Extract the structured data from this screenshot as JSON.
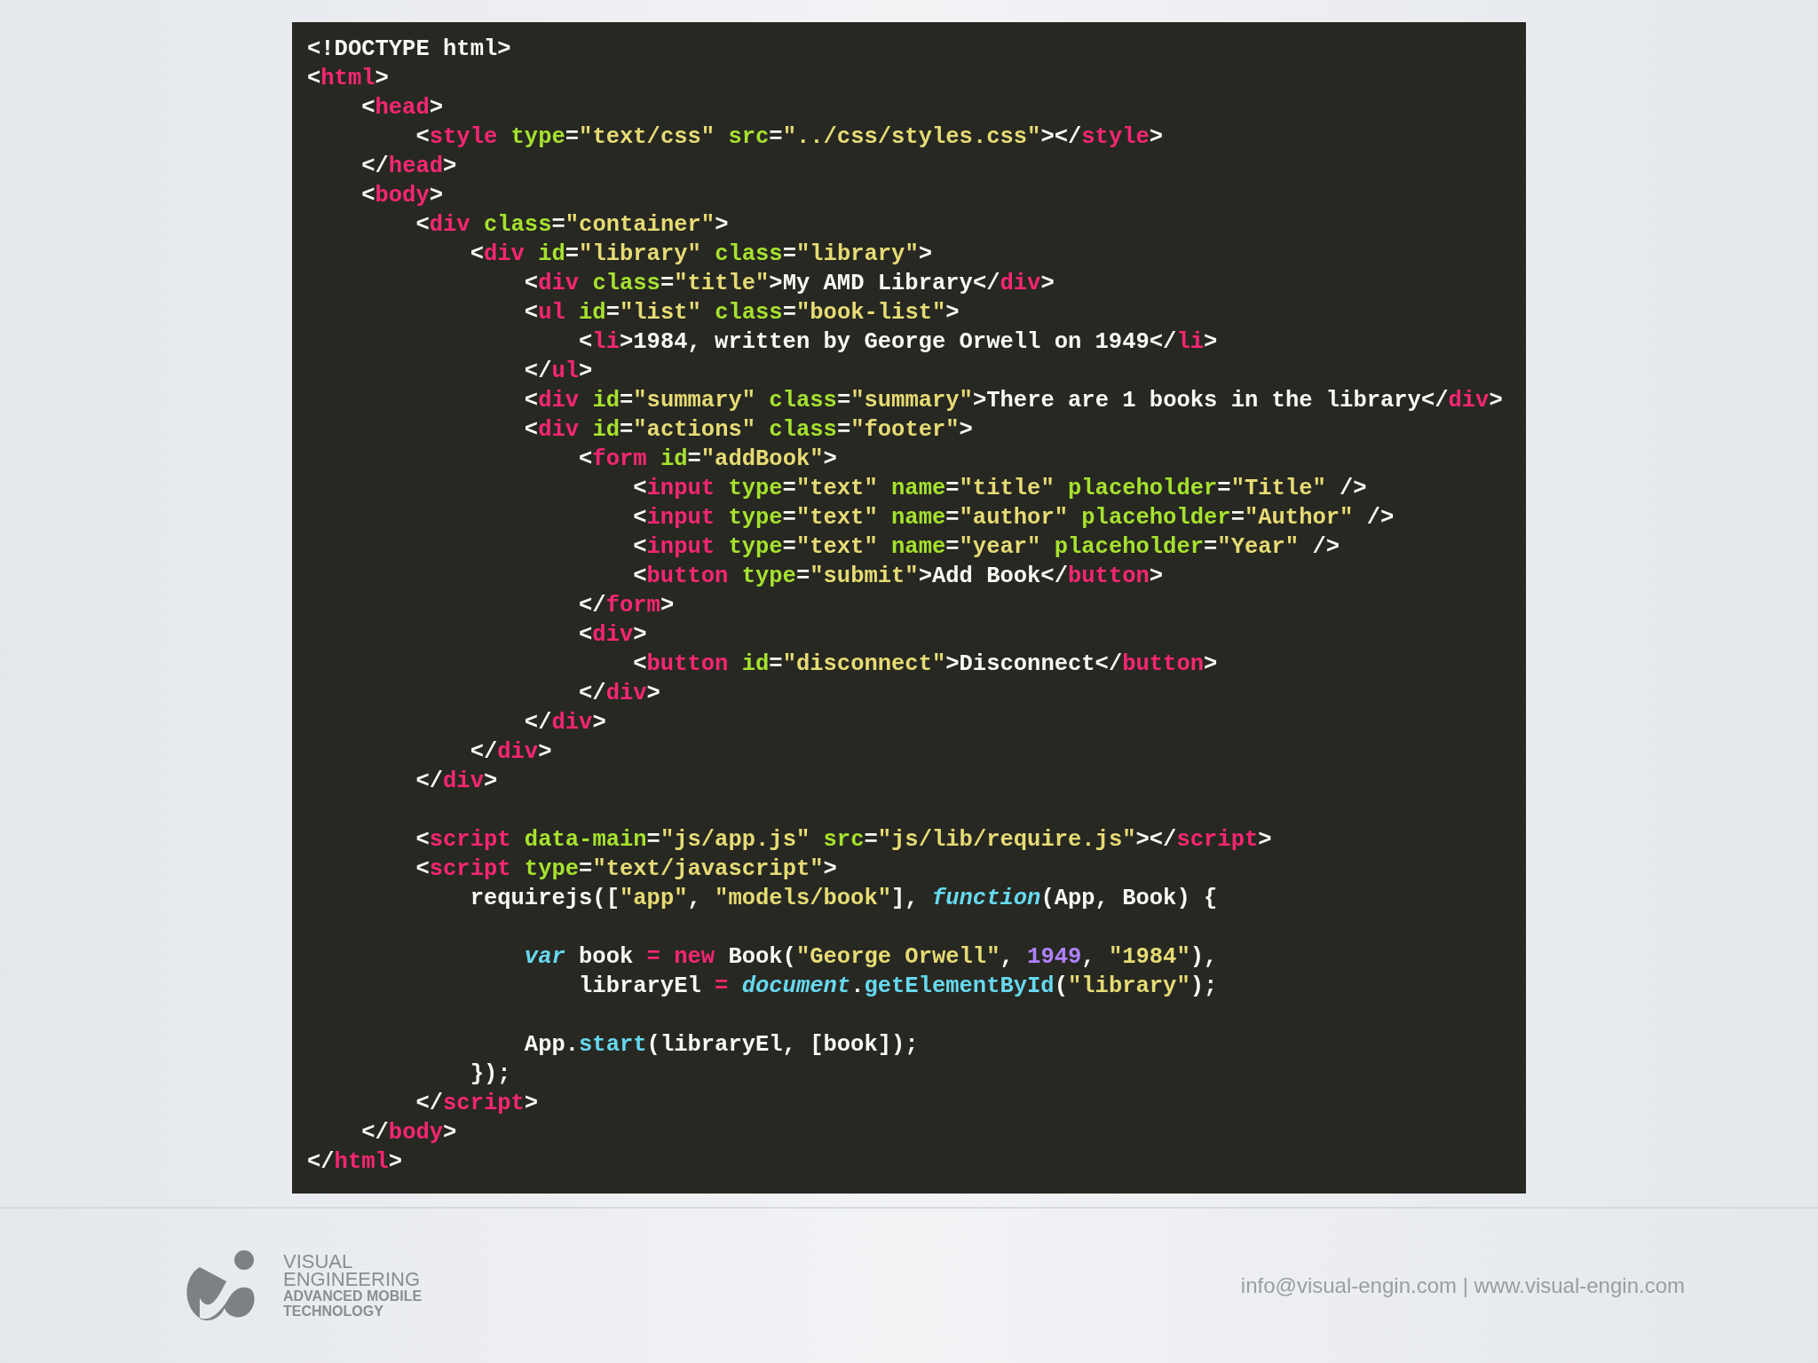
{
  "code_lines": [
    {
      "kind": "code",
      "tokens": [
        {
          "kind": "p",
          "text": "<!DOCTYPE html>"
        }
      ]
    },
    {
      "kind": "code",
      "tokens": [
        {
          "kind": "p",
          "text": "<"
        },
        {
          "kind": "t",
          "text": "html"
        },
        {
          "kind": "p",
          "text": ">"
        }
      ]
    },
    {
      "kind": "code",
      "tokens": [
        {
          "kind": "p",
          "text": "    <"
        },
        {
          "kind": "t",
          "text": "head"
        },
        {
          "kind": "p",
          "text": ">"
        }
      ]
    },
    {
      "kind": "code",
      "tokens": [
        {
          "kind": "p",
          "text": "        <"
        },
        {
          "kind": "t",
          "text": "style"
        },
        {
          "kind": "a",
          "text": " type"
        },
        {
          "kind": "p",
          "text": "="
        },
        {
          "kind": "s",
          "text": "\"text/css\""
        },
        {
          "kind": "a",
          "text": " src"
        },
        {
          "kind": "p",
          "text": "="
        },
        {
          "kind": "s",
          "text": "\"../css/styles.css\""
        },
        {
          "kind": "p",
          "text": "></"
        },
        {
          "kind": "t",
          "text": "style"
        },
        {
          "kind": "p",
          "text": ">"
        }
      ]
    },
    {
      "kind": "code",
      "tokens": [
        {
          "kind": "p",
          "text": "    </"
        },
        {
          "kind": "t",
          "text": "head"
        },
        {
          "kind": "p",
          "text": ">"
        }
      ]
    },
    {
      "kind": "code",
      "tokens": [
        {
          "kind": "p",
          "text": "    <"
        },
        {
          "kind": "t",
          "text": "body"
        },
        {
          "kind": "p",
          "text": ">"
        }
      ]
    },
    {
      "kind": "code",
      "tokens": [
        {
          "kind": "p",
          "text": "        <"
        },
        {
          "kind": "t",
          "text": "div"
        },
        {
          "kind": "a",
          "text": " class"
        },
        {
          "kind": "p",
          "text": "="
        },
        {
          "kind": "s",
          "text": "\"container\""
        },
        {
          "kind": "p",
          "text": ">"
        }
      ]
    },
    {
      "kind": "code",
      "tokens": [
        {
          "kind": "p",
          "text": "            <"
        },
        {
          "kind": "t",
          "text": "div"
        },
        {
          "kind": "a",
          "text": " id"
        },
        {
          "kind": "p",
          "text": "="
        },
        {
          "kind": "s",
          "text": "\"library\""
        },
        {
          "kind": "a",
          "text": " class"
        },
        {
          "kind": "p",
          "text": "="
        },
        {
          "kind": "s",
          "text": "\"library\""
        },
        {
          "kind": "p",
          "text": ">"
        }
      ]
    },
    {
      "kind": "code",
      "tokens": [
        {
          "kind": "p",
          "text": "                <"
        },
        {
          "kind": "t",
          "text": "div"
        },
        {
          "kind": "a",
          "text": " class"
        },
        {
          "kind": "p",
          "text": "="
        },
        {
          "kind": "s",
          "text": "\"title\""
        },
        {
          "kind": "p",
          "text": ">My AMD Library</"
        },
        {
          "kind": "t",
          "text": "div"
        },
        {
          "kind": "p",
          "text": ">"
        }
      ]
    },
    {
      "kind": "code",
      "tokens": [
        {
          "kind": "p",
          "text": "                <"
        },
        {
          "kind": "t",
          "text": "ul"
        },
        {
          "kind": "a",
          "text": " id"
        },
        {
          "kind": "p",
          "text": "="
        },
        {
          "kind": "s",
          "text": "\"list\""
        },
        {
          "kind": "a",
          "text": " class"
        },
        {
          "kind": "p",
          "text": "="
        },
        {
          "kind": "s",
          "text": "\"book-list\""
        },
        {
          "kind": "p",
          "text": ">"
        }
      ]
    },
    {
      "kind": "code",
      "tokens": [
        {
          "kind": "p",
          "text": "                    <"
        },
        {
          "kind": "t",
          "text": "li"
        },
        {
          "kind": "p",
          "text": ">1984, written by George Orwell on 1949</"
        },
        {
          "kind": "t",
          "text": "li"
        },
        {
          "kind": "p",
          "text": ">"
        }
      ]
    },
    {
      "kind": "code",
      "tokens": [
        {
          "kind": "p",
          "text": "                </"
        },
        {
          "kind": "t",
          "text": "ul"
        },
        {
          "kind": "p",
          "text": ">"
        }
      ]
    },
    {
      "kind": "code",
      "tokens": [
        {
          "kind": "p",
          "text": "                <"
        },
        {
          "kind": "t",
          "text": "div"
        },
        {
          "kind": "a",
          "text": " id"
        },
        {
          "kind": "p",
          "text": "="
        },
        {
          "kind": "s",
          "text": "\"summary\""
        },
        {
          "kind": "a",
          "text": " class"
        },
        {
          "kind": "p",
          "text": "="
        },
        {
          "kind": "s",
          "text": "\"summary\""
        },
        {
          "kind": "p",
          "text": ">There are 1 books in the library</"
        },
        {
          "kind": "t",
          "text": "div"
        },
        {
          "kind": "p",
          "text": ">"
        }
      ]
    },
    {
      "kind": "code",
      "tokens": [
        {
          "kind": "p",
          "text": "                <"
        },
        {
          "kind": "t",
          "text": "div"
        },
        {
          "kind": "a",
          "text": " id"
        },
        {
          "kind": "p",
          "text": "="
        },
        {
          "kind": "s",
          "text": "\"actions\""
        },
        {
          "kind": "a",
          "text": " class"
        },
        {
          "kind": "p",
          "text": "="
        },
        {
          "kind": "s",
          "text": "\"footer\""
        },
        {
          "kind": "p",
          "text": ">"
        }
      ]
    },
    {
      "kind": "code",
      "tokens": [
        {
          "kind": "p",
          "text": "                    <"
        },
        {
          "kind": "t",
          "text": "form"
        },
        {
          "kind": "a",
          "text": " id"
        },
        {
          "kind": "p",
          "text": "="
        },
        {
          "kind": "s",
          "text": "\"addBook\""
        },
        {
          "kind": "p",
          "text": ">"
        }
      ]
    },
    {
      "kind": "code",
      "tokens": [
        {
          "kind": "p",
          "text": "                        <"
        },
        {
          "kind": "t",
          "text": "input"
        },
        {
          "kind": "a",
          "text": " type"
        },
        {
          "kind": "p",
          "text": "="
        },
        {
          "kind": "s",
          "text": "\"text\""
        },
        {
          "kind": "a",
          "text": " name"
        },
        {
          "kind": "p",
          "text": "="
        },
        {
          "kind": "s",
          "text": "\"title\""
        },
        {
          "kind": "a",
          "text": " placeholder"
        },
        {
          "kind": "p",
          "text": "="
        },
        {
          "kind": "s",
          "text": "\"Title\""
        },
        {
          "kind": "p",
          "text": " />"
        }
      ]
    },
    {
      "kind": "code",
      "tokens": [
        {
          "kind": "p",
          "text": "                        <"
        },
        {
          "kind": "t",
          "text": "input"
        },
        {
          "kind": "a",
          "text": " type"
        },
        {
          "kind": "p",
          "text": "="
        },
        {
          "kind": "s",
          "text": "\"text\""
        },
        {
          "kind": "a",
          "text": " name"
        },
        {
          "kind": "p",
          "text": "="
        },
        {
          "kind": "s",
          "text": "\"author\""
        },
        {
          "kind": "a",
          "text": " placeholder"
        },
        {
          "kind": "p",
          "text": "="
        },
        {
          "kind": "s",
          "text": "\"Author\""
        },
        {
          "kind": "p",
          "text": " />"
        }
      ]
    },
    {
      "kind": "code",
      "tokens": [
        {
          "kind": "p",
          "text": "                        <"
        },
        {
          "kind": "t",
          "text": "input"
        },
        {
          "kind": "a",
          "text": " type"
        },
        {
          "kind": "p",
          "text": "="
        },
        {
          "kind": "s",
          "text": "\"text\""
        },
        {
          "kind": "a",
          "text": " name"
        },
        {
          "kind": "p",
          "text": "="
        },
        {
          "kind": "s",
          "text": "\"year\""
        },
        {
          "kind": "a",
          "text": " placeholder"
        },
        {
          "kind": "p",
          "text": "="
        },
        {
          "kind": "s",
          "text": "\"Year\""
        },
        {
          "kind": "p",
          "text": " />"
        }
      ]
    },
    {
      "kind": "code",
      "tokens": [
        {
          "kind": "p",
          "text": "                        <"
        },
        {
          "kind": "t",
          "text": "button"
        },
        {
          "kind": "a",
          "text": " type"
        },
        {
          "kind": "p",
          "text": "="
        },
        {
          "kind": "s",
          "text": "\"submit\""
        },
        {
          "kind": "p",
          "text": ">Add Book</"
        },
        {
          "kind": "t",
          "text": "button"
        },
        {
          "kind": "p",
          "text": ">"
        }
      ]
    },
    {
      "kind": "code",
      "tokens": [
        {
          "kind": "p",
          "text": "                    </"
        },
        {
          "kind": "t",
          "text": "form"
        },
        {
          "kind": "p",
          "text": ">"
        }
      ]
    },
    {
      "kind": "code",
      "tokens": [
        {
          "kind": "p",
          "text": "                    <"
        },
        {
          "kind": "t",
          "text": "div"
        },
        {
          "kind": "p",
          "text": ">"
        }
      ]
    },
    {
      "kind": "code",
      "tokens": [
        {
          "kind": "p",
          "text": "                        <"
        },
        {
          "kind": "t",
          "text": "button"
        },
        {
          "kind": "a",
          "text": " id"
        },
        {
          "kind": "p",
          "text": "="
        },
        {
          "kind": "s",
          "text": "\"disconnect\""
        },
        {
          "kind": "p",
          "text": ">Disconnect</"
        },
        {
          "kind": "t",
          "text": "button"
        },
        {
          "kind": "p",
          "text": ">"
        }
      ]
    },
    {
      "kind": "code",
      "tokens": [
        {
          "kind": "p",
          "text": "                    </"
        },
        {
          "kind": "t",
          "text": "div"
        },
        {
          "kind": "p",
          "text": ">"
        }
      ]
    },
    {
      "kind": "code",
      "tokens": [
        {
          "kind": "p",
          "text": "                </"
        },
        {
          "kind": "t",
          "text": "div"
        },
        {
          "kind": "p",
          "text": ">"
        }
      ]
    },
    {
      "kind": "code",
      "tokens": [
        {
          "kind": "p",
          "text": "            </"
        },
        {
          "kind": "t",
          "text": "div"
        },
        {
          "kind": "p",
          "text": ">"
        }
      ]
    },
    {
      "kind": "code",
      "tokens": [
        {
          "kind": "p",
          "text": "        </"
        },
        {
          "kind": "t",
          "text": "div"
        },
        {
          "kind": "p",
          "text": ">"
        }
      ]
    },
    {
      "kind": "blank"
    },
    {
      "kind": "code",
      "tokens": [
        {
          "kind": "p",
          "text": "        <"
        },
        {
          "kind": "t",
          "text": "script"
        },
        {
          "kind": "a",
          "text": " data-main"
        },
        {
          "kind": "p",
          "text": "="
        },
        {
          "kind": "s",
          "text": "\"js/app.js\""
        },
        {
          "kind": "a",
          "text": " src"
        },
        {
          "kind": "p",
          "text": "="
        },
        {
          "kind": "s",
          "text": "\"js/lib/require.js\""
        },
        {
          "kind": "p",
          "text": "></"
        },
        {
          "kind": "t",
          "text": "script"
        },
        {
          "kind": "p",
          "text": ">"
        }
      ]
    },
    {
      "kind": "code",
      "tokens": [
        {
          "kind": "p",
          "text": "        <"
        },
        {
          "kind": "t",
          "text": "script"
        },
        {
          "kind": "a",
          "text": " type"
        },
        {
          "kind": "p",
          "text": "="
        },
        {
          "kind": "s",
          "text": "\"text/javascript\""
        },
        {
          "kind": "p",
          "text": ">"
        }
      ]
    },
    {
      "kind": "code",
      "tokens": [
        {
          "kind": "p",
          "text": "            requirejs(["
        },
        {
          "kind": "s",
          "text": "\"app\""
        },
        {
          "kind": "p",
          "text": ", "
        },
        {
          "kind": "s",
          "text": "\"models/book\""
        },
        {
          "kind": "p",
          "text": "], "
        },
        {
          "kind": "i",
          "text": "function"
        },
        {
          "kind": "p",
          "text": "(App, Book) {"
        }
      ]
    },
    {
      "kind": "blank"
    },
    {
      "kind": "code",
      "tokens": [
        {
          "kind": "i",
          "text": "                var"
        },
        {
          "kind": "p",
          "text": " book "
        },
        {
          "kind": "k",
          "text": "= new"
        },
        {
          "kind": "p",
          "text": " Book("
        },
        {
          "kind": "s",
          "text": "\"George Orwell\""
        },
        {
          "kind": "p",
          "text": ", "
        },
        {
          "kind": "n",
          "text": "1949"
        },
        {
          "kind": "p",
          "text": ", "
        },
        {
          "kind": "s",
          "text": "\"1984\""
        },
        {
          "kind": "p",
          "text": "),"
        }
      ]
    },
    {
      "kind": "code",
      "tokens": [
        {
          "kind": "p",
          "text": "                    libraryEl "
        },
        {
          "kind": "k",
          "text": "="
        },
        {
          "kind": "i",
          "text": " document"
        },
        {
          "kind": "p",
          "text": "."
        },
        {
          "kind": "f",
          "text": "getElementById"
        },
        {
          "kind": "p",
          "text": "("
        },
        {
          "kind": "s",
          "text": "\"library\""
        },
        {
          "kind": "p",
          "text": ");"
        }
      ]
    },
    {
      "kind": "blank"
    },
    {
      "kind": "code",
      "tokens": [
        {
          "kind": "p",
          "text": "                App."
        },
        {
          "kind": "f",
          "text": "start"
        },
        {
          "kind": "p",
          "text": "(libraryEl, [book]);"
        }
      ]
    },
    {
      "kind": "code",
      "tokens": [
        {
          "kind": "p",
          "text": "            });"
        }
      ]
    },
    {
      "kind": "code",
      "tokens": [
        {
          "kind": "p",
          "text": "        </"
        },
        {
          "kind": "t",
          "text": "script"
        },
        {
          "kind": "p",
          "text": ">"
        }
      ]
    },
    {
      "kind": "code",
      "tokens": [
        {
          "kind": "p",
          "text": "    </"
        },
        {
          "kind": "t",
          "text": "body"
        },
        {
          "kind": "p",
          "text": ">"
        }
      ]
    },
    {
      "kind": "code",
      "tokens": [
        {
          "kind": "p",
          "text": "</"
        },
        {
          "kind": "t",
          "text": "html"
        },
        {
          "kind": "p",
          "text": ">"
        }
      ]
    }
  ],
  "footer": {
    "logo_lines": [
      "VISUAL",
      "ENGINEERING",
      "ADVANCED MOBILE",
      "TECHNOLOGY"
    ],
    "contact": "info@visual-engin.com | www.visual-engin.com"
  }
}
